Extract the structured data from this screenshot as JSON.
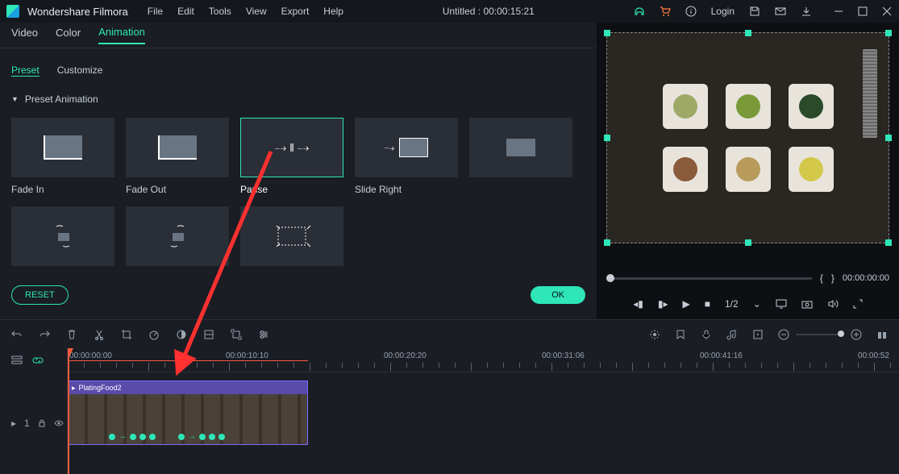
{
  "app": {
    "name": "Wondershare Filmora",
    "title": "Untitled : 00:00:15:21"
  },
  "menu": {
    "file": "File",
    "edit": "Edit",
    "tools": "Tools",
    "view": "View",
    "export": "Export",
    "help": "Help"
  },
  "login": "Login",
  "subtabs": {
    "video": "Video",
    "color": "Color",
    "animation": "Animation"
  },
  "subtabs2": {
    "preset": "Preset",
    "customize": "Customize"
  },
  "section": {
    "title": "Preset Animation"
  },
  "presets": {
    "fadein": "Fade In",
    "fadeout": "Fade Out",
    "pause": "Pause",
    "slide": "Slide Right"
  },
  "buttons": {
    "reset": "RESET",
    "ok": "OK"
  },
  "preview": {
    "braces_l": "{",
    "braces_r": "}",
    "time": "00:00:00:00",
    "ratio": "1/2"
  },
  "ruler": {
    "t0": "00:00:00:00",
    "t1": "00:00:10:10",
    "t2": "00:00:20:20",
    "t3": "00:00:31:06",
    "t4": "00:00:41:16",
    "t5": "00:00:52"
  },
  "clip": {
    "name": "PlatingFood2"
  },
  "track": {
    "label": "1"
  }
}
